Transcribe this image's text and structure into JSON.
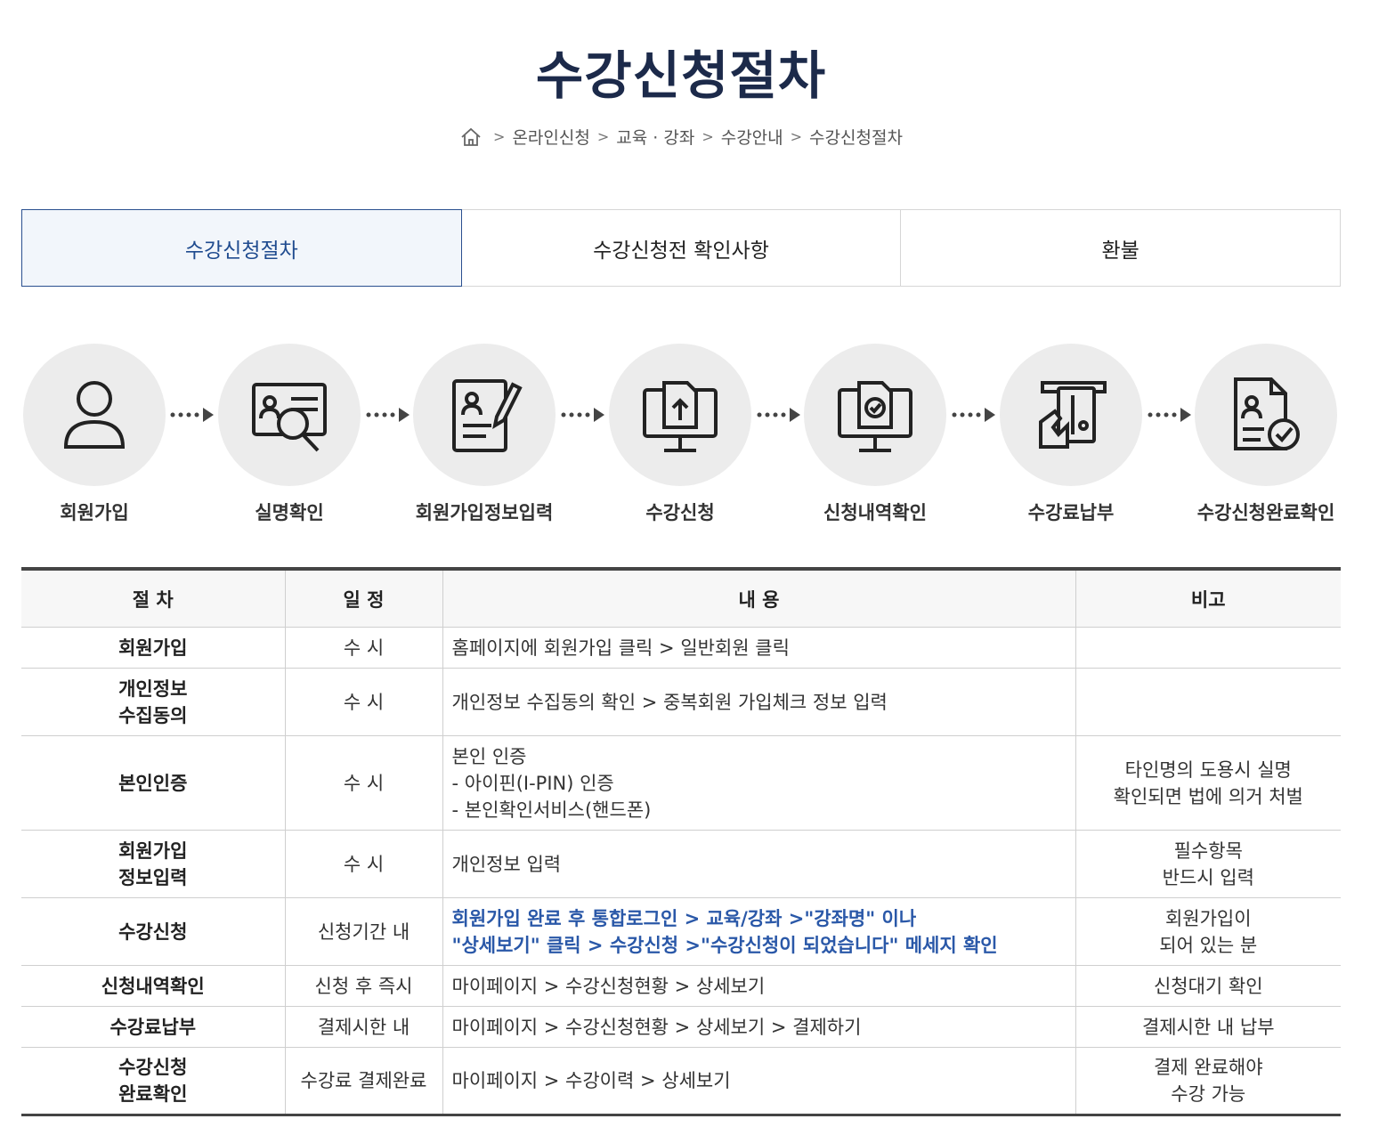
{
  "page": {
    "title": "수강신청절차"
  },
  "breadcrumb": {
    "home_icon": "home-icon",
    "items": [
      "온라인신청",
      "교육 · 강좌",
      "수강안내",
      "수강신청절차"
    ]
  },
  "tabs": [
    {
      "label": "수강신청절차",
      "active": true
    },
    {
      "label": "수강신청전 확인사항",
      "active": false
    },
    {
      "label": "환불",
      "active": false
    }
  ],
  "steps": [
    {
      "label": "회원가입",
      "icon": "user-icon"
    },
    {
      "label": "실명확인",
      "icon": "id-card-search-icon"
    },
    {
      "label": "회원가입정보입력",
      "icon": "form-pen-icon"
    },
    {
      "label": "수강신청",
      "icon": "monitor-upload-icon"
    },
    {
      "label": "신청내역확인",
      "icon": "monitor-check-icon"
    },
    {
      "label": "수강료납부",
      "icon": "card-payment-icon"
    },
    {
      "label": "수강신청완료확인",
      "icon": "document-check-icon"
    }
  ],
  "table": {
    "headers": [
      "절 차",
      "일 정",
      "내 용",
      "비고"
    ],
    "rows": [
      {
        "step": "회원가입",
        "schedule": "수 시",
        "content": "홈페이지에 회원가입 클릭 > 일반회원 클릭",
        "note": ""
      },
      {
        "step": "개인정보\n수집동의",
        "schedule": "수 시",
        "content": "개인정보 수집동의 확인 > 중복회원 가입체크 정보 입력",
        "note": ""
      },
      {
        "step": "본인인증",
        "schedule": "수 시",
        "content": "본인 인증\n- 아이핀(I-PIN) 인증\n- 본인확인서비스(핸드폰)",
        "note": "타인명의 도용시 실명\n확인되면 법에 의거 처벌"
      },
      {
        "step": "회원가입\n정보입력",
        "schedule": "수 시",
        "content": "개인정보 입력",
        "note": "필수항목\n반드시 입력"
      },
      {
        "step": "수강신청",
        "schedule": "신청기간 내",
        "content": "회원가입 완료 후 통합로그인 > 교육/강좌 >\"강좌명\" 이나\n\"상세보기\" 클릭 > 수강신청 >\"수강신청이 되었습니다\" 메세지 확인",
        "note": "회원가입이\n되어 있는 분",
        "highlight": true
      },
      {
        "step": "신청내역확인",
        "schedule": "신청 후 즉시",
        "content": "마이페이지 > 수강신청현황 > 상세보기",
        "note": "신청대기 확인"
      },
      {
        "step": "수강료납부",
        "schedule": "결제시한 내",
        "content": "마이페이지 > 수강신청현황 > 상세보기 > 결제하기",
        "note": "결제시한 내 납부"
      },
      {
        "step": "수강신청\n완료확인",
        "schedule": "수강료 결제완료",
        "content": "마이페이지 > 수강이력 > 상세보기",
        "note": "결제 완료해야\n수강 가능"
      }
    ]
  },
  "colors": {
    "title": "#1c2a4a",
    "accent": "#1f4b8f",
    "highlight_text": "#2a58a8",
    "circle_bg": "#ececec"
  }
}
